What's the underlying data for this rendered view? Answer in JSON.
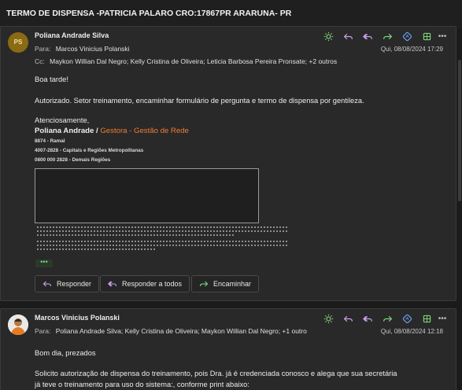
{
  "subject": "TERMO DE DISPENSA -PATRICIA PALARO CRO:17867PR ARARUNA- PR",
  "colors": {
    "accent": "#7ad27a",
    "reply_purple": "#c7a0ea",
    "forward_green": "#7ad27a",
    "brand_orange": "#f07d33"
  },
  "message1": {
    "avatar_initials": "PS",
    "sender": "Poliana Andrade Silva",
    "to_label": "Para:",
    "to": "Marcos Vinicius Polanski",
    "cc_label": "Cc:",
    "cc": "Maykon Willian Dal Negro;   Kelly Cristina de Oliveira;   Leticia Barbosa Pereira Pronsate;   +2 outros",
    "date": "Qui, 08/08/2024 17:29",
    "greeting": "Boa tarde!",
    "text": "Autorizado. Setor treinamento, encaminhar formulário de pergunta e termo de dispensa por gentileza.",
    "closing": "Atenciosamente,",
    "signature": {
      "name": "Poliana Andrade / ",
      "role": "Gestora  - Gestão de Rede",
      "phone1": "8874 - Ramal",
      "phone2": "4007-2828 - Capitais e Regiões Metropolitanas",
      "phone3": "0800 000 2828 - Demais Regiões"
    },
    "expand_label": "•••",
    "buttons": {
      "reply": "Responder",
      "reply_all": "Responder a todos",
      "forward": "Encaminhar"
    }
  },
  "message2": {
    "sender": "Marcos Vinicius Polanski",
    "to_label": "Para:",
    "to": "Poliana Andrade Silva;   Kelly Cristina de Oliveira;   Maykon Willian Dal Negro;   +1 outro",
    "date": "Qui, 08/08/2024 12:18",
    "greeting": "Bom dia, prezados",
    "text_line1": "Solicito autorização de dispensa do treinamento, pois Dra. já é credenciada conosco e alega que sua secretária",
    "text_line2": "já teve o treinamento para uso do sistema:, conforme print abaixo:"
  },
  "icons": [
    "summarize-icon",
    "reply-icon",
    "reply-all-icon",
    "forward-icon",
    "translate-icon",
    "apps-icon",
    "more-icon"
  ]
}
